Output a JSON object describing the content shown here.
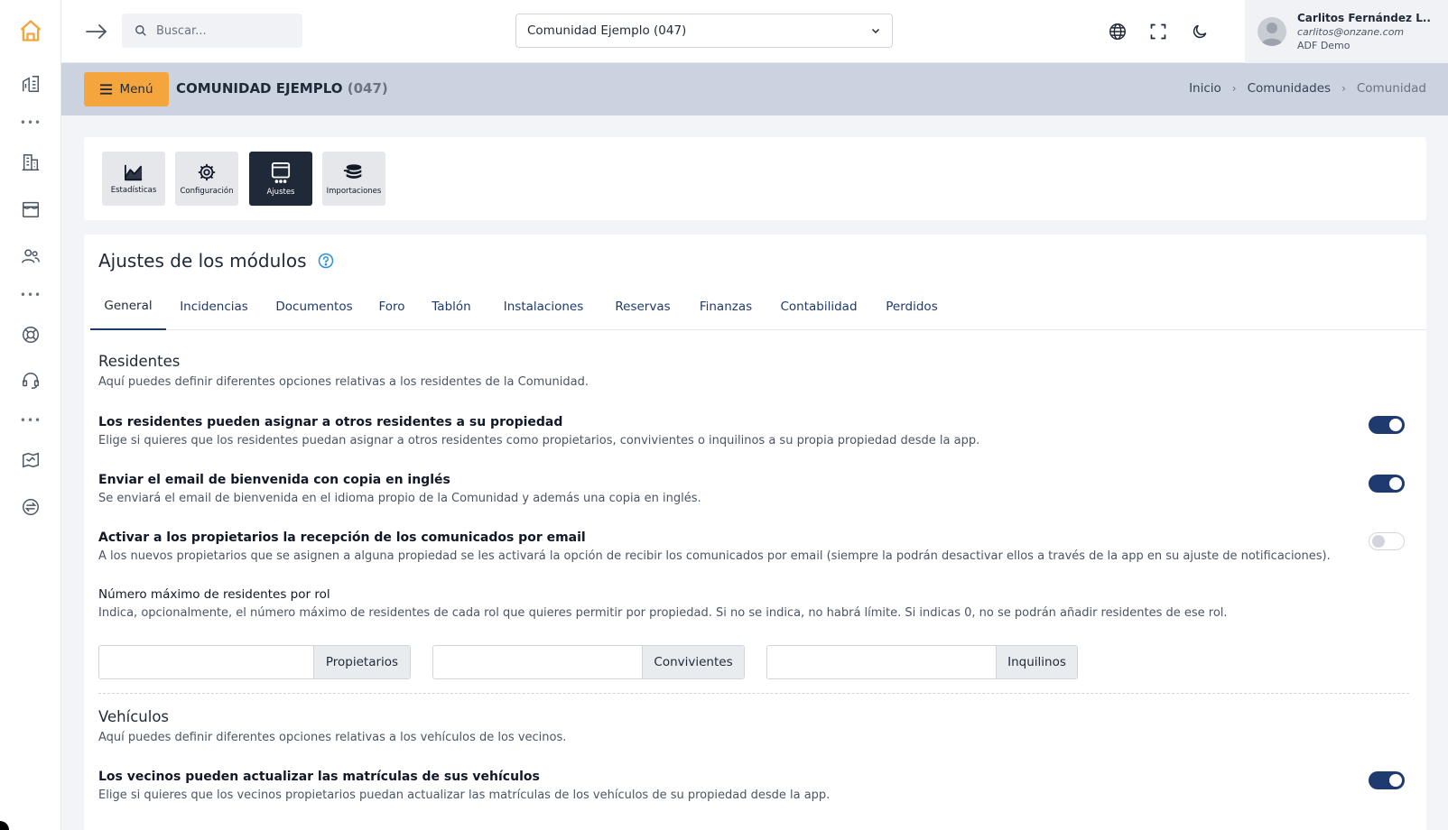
{
  "sidebar": {
    "icons": [
      "home-icon",
      "building-chart-icon",
      "more-icon",
      "buildings-icon",
      "storefront-icon",
      "users-icon",
      "more-icon",
      "lifebuoy-icon",
      "headset-icon",
      "more-icon",
      "map-icon",
      "exchange-icon"
    ]
  },
  "topbar": {
    "search_placeholder": "Buscar...",
    "community_select": "Comunidad Ejemplo (047)",
    "user": {
      "name": "Carlitos Fernández L..",
      "email": "carlitos@onzane.com",
      "org": "ADF Demo"
    }
  },
  "subheader": {
    "menu_label": "Menú",
    "title": "COMUNIDAD EJEMPLO",
    "title_code": "(047)",
    "breadcrumb": [
      "Inicio",
      "Comunidades",
      "Comunidad"
    ]
  },
  "toolbar": {
    "tools": [
      {
        "label": "Estadísticas",
        "active": false
      },
      {
        "label": "Configuración",
        "active": false
      },
      {
        "label": "Ajustes",
        "active": true
      },
      {
        "label": "Importaciones",
        "active": false
      }
    ]
  },
  "main": {
    "title": "Ajustes de los módulos",
    "tabs": [
      "General",
      "Incidencias",
      "Documentos",
      "Foro",
      "Tablón",
      "Instalaciones",
      "Reservas",
      "Finanzas",
      "Contabilidad",
      "Perdidos"
    ],
    "active_tab": "General",
    "residentes": {
      "title": "Residentes",
      "desc": "Aquí puedes definir diferentes opciones relativas a los residentes de la Comunidad.",
      "options": [
        {
          "title": "Los residentes pueden asignar a otros residentes a su propiedad",
          "desc": "Elige si quieres que los residentes puedan asignar a otros residentes como propietarios, convivientes o inquilinos a su propia propiedad desde la app.",
          "enabled": true
        },
        {
          "title": "Enviar el email de bienvenida con copia en inglés",
          "desc": "Se enviará el email de bienvenida en el idioma propio de la Comunidad y además una copia en inglés.",
          "enabled": true
        },
        {
          "title": "Activar a los propietarios la recepción de los comunicados por email",
          "desc": "A los nuevos propietarios que se asignen a alguna propiedad se les activará la opción de recibir los comunicados por email (siempre la podrán desactivar ellos a través de la app en su ajuste de notificaciones).",
          "enabled": false
        }
      ],
      "max_title": "Número máximo de residentes por rol",
      "max_desc": "Indica, opcionalmente, el número máximo de residentes de cada rol que quieres permitir por propiedad. Si no se indica, no habrá límite. Si indicas 0, no se podrán añadir residentes de ese rol.",
      "roles": [
        {
          "label": "Propietarios",
          "value": ""
        },
        {
          "label": "Convivientes",
          "value": ""
        },
        {
          "label": "Inquilinos",
          "value": ""
        }
      ]
    },
    "vehiculos": {
      "title": "Vehículos",
      "desc": "Aquí puedes definir diferentes opciones relativas a los vehículos de los vecinos.",
      "options": [
        {
          "title": "Los vecinos pueden actualizar las matrículas de sus vehículos",
          "desc": "Elige si quieres que los vecinos propietarios puedan actualizar las matrículas de los vehículos de su propiedad desde la app.",
          "enabled": true
        }
      ]
    }
  },
  "colors": {
    "accent": "#f5a53e",
    "primary": "#1e3a6e",
    "subheader_bg": "#ccd3e0"
  }
}
